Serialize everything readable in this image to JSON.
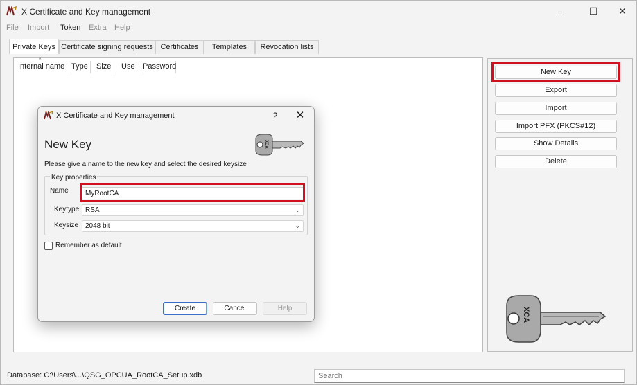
{
  "window": {
    "title": "X Certificate and Key management",
    "minimize": "—",
    "maximize": "☐",
    "close": "✕"
  },
  "menu": {
    "items": [
      {
        "label": "File",
        "enabled": false
      },
      {
        "label": "Import",
        "enabled": false
      },
      {
        "label": "Token",
        "enabled": true
      },
      {
        "label": "Extra",
        "enabled": false
      },
      {
        "label": "Help",
        "enabled": false
      }
    ]
  },
  "tabs": [
    {
      "label": "Private Keys",
      "selected": true
    },
    {
      "label": "Certificate signing requests",
      "selected": false
    },
    {
      "label": "Certificates",
      "selected": false
    },
    {
      "label": "Templates",
      "selected": false
    },
    {
      "label": "Revocation lists",
      "selected": false
    }
  ],
  "columns": [
    "Internal name",
    "Type",
    "Size",
    "Use",
    "Password"
  ],
  "side_buttons": {
    "new_key": "New Key",
    "export": "Export",
    "import": "Import",
    "import_pfx": "Import PFX (PKCS#12)",
    "show_details": "Show Details",
    "delete": "Delete"
  },
  "status": {
    "database": "Database: C:\\Users\\...\\QSG_OPCUA_RootCA_Setup.xdb",
    "search_placeholder": "Search"
  },
  "dialog": {
    "title": "X Certificate and Key management",
    "help": "?",
    "close": "✕",
    "heading": "New Key",
    "description": "Please give a name to the new key and select the desired keysize",
    "group_title": "Key properties",
    "name_label": "Name",
    "name_value": "MyRootCA",
    "keytype_label": "Keytype",
    "keytype_value": "RSA",
    "keysize_label": "Keysize",
    "keysize_value": "2048 bit",
    "remember_label": "Remember as default",
    "remember_checked": false,
    "create": "Create",
    "cancel": "Cancel",
    "help_button": "Help"
  },
  "colors": {
    "highlight": "#d1101f",
    "default_button_border": "#3a6ec9"
  }
}
